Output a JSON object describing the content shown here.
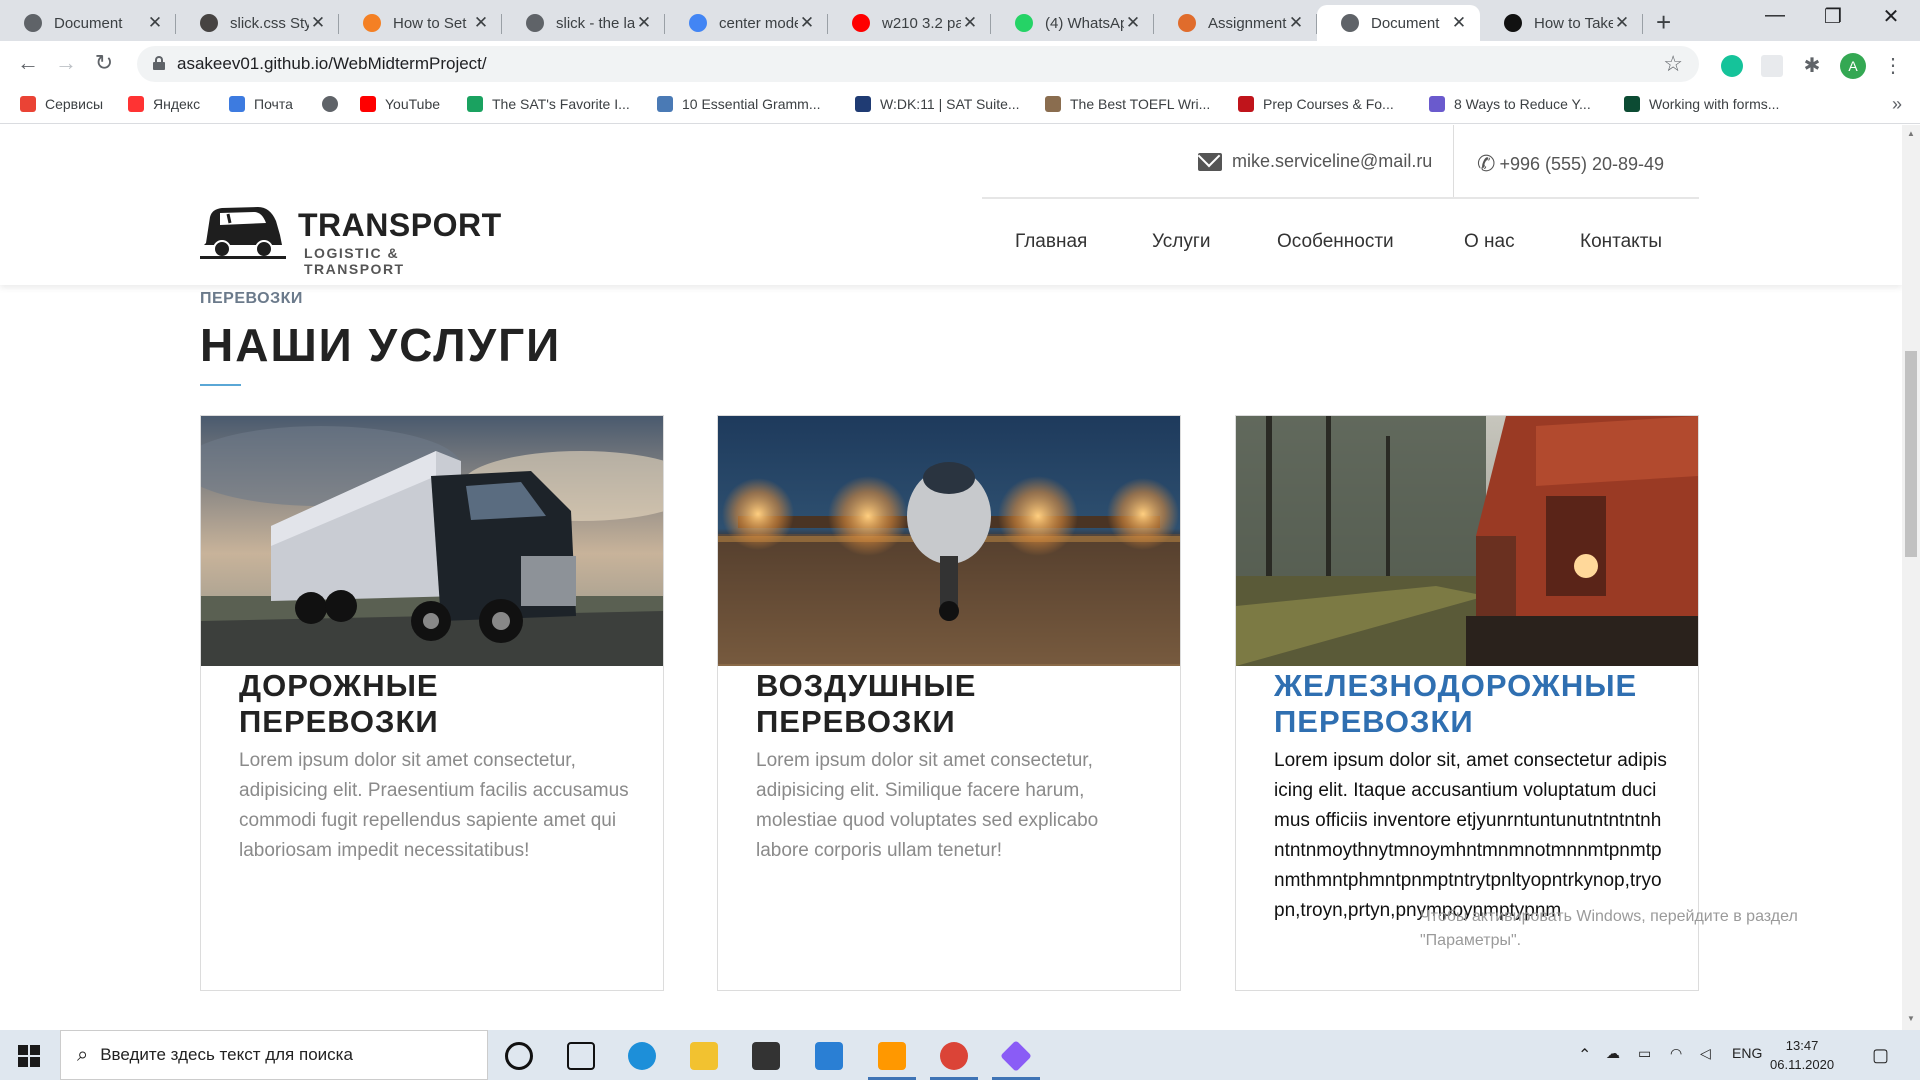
{
  "browser": {
    "tabs": [
      {
        "title": "Document",
        "favicon_color": "#5f6368",
        "active": false
      },
      {
        "title": "slick.css Style",
        "favicon_color": "#464342",
        "active": false
      },
      {
        "title": "How to Set",
        "favicon_color": "#f48024",
        "active": false
      },
      {
        "title": "slick - the la",
        "favicon_color": "#5f6368",
        "active": false
      },
      {
        "title": "center mode",
        "favicon_color": "#4285f4",
        "active": false
      },
      {
        "title": "w210 3.2 pa",
        "favicon_color": "#ff0000",
        "active": false
      },
      {
        "title": "(4) WhatsAp",
        "favicon_color": "#25d366",
        "active": false
      },
      {
        "title": "Assignment",
        "favicon_color": "#e06c2c",
        "active": false
      },
      {
        "title": "Document",
        "favicon_color": "#5f6368",
        "active": true
      },
      {
        "title": "How to Take",
        "favicon_color": "#111111",
        "active": false
      }
    ],
    "new_tab_glyph": "+",
    "close_glyph": "✕",
    "window_controls": [
      "—",
      "❐",
      "✕"
    ],
    "url": "asakeev01.github.io/WebMidtermProject/",
    "profile_initial": "A",
    "bookmarks": [
      {
        "label": "Сервисы",
        "icon_color": "#ea4335"
      },
      {
        "label": "Яндекс",
        "icon_color": "#ff3333"
      },
      {
        "label": "Почта",
        "icon_color": "#3d7be0"
      },
      {
        "label": "",
        "icon_color": "#5f6368"
      },
      {
        "label": "YouTube",
        "icon_color": "#ff0000"
      },
      {
        "label": "The SAT's Favorite I...",
        "icon_color": "#1aa260"
      },
      {
        "label": "10 Essential Gramm...",
        "icon_color": "#4a7ab5"
      },
      {
        "label": "W:DK:11 | SAT Suite...",
        "icon_color": "#1f3b73"
      },
      {
        "label": "The Best TOEFL Wri...",
        "icon_color": "#8a6d4f"
      },
      {
        "label": "Prep Courses & Fo...",
        "icon_color": "#c0141b"
      },
      {
        "label": "8 Ways to Reduce Y...",
        "icon_color": "#6a5acd"
      },
      {
        "label": "Working with forms...",
        "icon_color": "#0c4b33"
      }
    ],
    "bookmarks_more": "»"
  },
  "site": {
    "email": "mike.serviceline@mail.ru",
    "phone": "+996 (555) 20-89-49",
    "logo_title": "TRANSPORT",
    "logo_subtitle": "LOGISTIC & TRANSPORT",
    "nav": [
      "Главная",
      "Услуги",
      "Особенности",
      "О нас",
      "Контакты"
    ],
    "kicker": "ПЕРЕВОЗКИ",
    "title": "НАШИ УСЛУГИ",
    "cards": [
      {
        "title_line1": "ДОРОЖНЫЕ",
        "title_line2": "ПЕРЕВОЗКИ",
        "text": "Lorem ipsum dolor sit amet consectetur, adipisicing elit. Praesentium facilis accusamus commodi fugit repellendus sapiente amet qui laboriosam impedit necessitatibus!"
      },
      {
        "title_line1": "ВОЗДУШНЫЕ",
        "title_line2": "ПЕРЕВОЗКИ",
        "text": "Lorem ipsum dolor sit amet consectetur, adipisicing elit. Similique facere harum, molestiae quod voluptates sed explicabo labore corporis ullam tenetur!"
      },
      {
        "title_line1": "ЖЕЛЕЗНОДОРОЖНЫЕ",
        "title_line2": "ПЕРЕВОЗКИ",
        "text": "Lorem ipsum dolor sit, amet consectetur adipisicing elit. Itaque accusantium voluptatum ducimus officiis inventore etjyunrntuntunutntntntnhntntnmoythnytmnoymhntmnmnotmnnmtpnmtpnmthmntphmntpnmptntrytpnltyopntrkynop,tryopn,troyn,prtyn,pnympoynmptypnm"
      }
    ],
    "watermark_line1": "Чтобы активировать Windows, перейдите в раздел",
    "watermark_line2": "\"Параметры\"."
  },
  "taskbar": {
    "search_placeholder": "Введите здесь текст для поиска",
    "language": "ENG",
    "time": "13:47",
    "date": "06.11.2020"
  }
}
